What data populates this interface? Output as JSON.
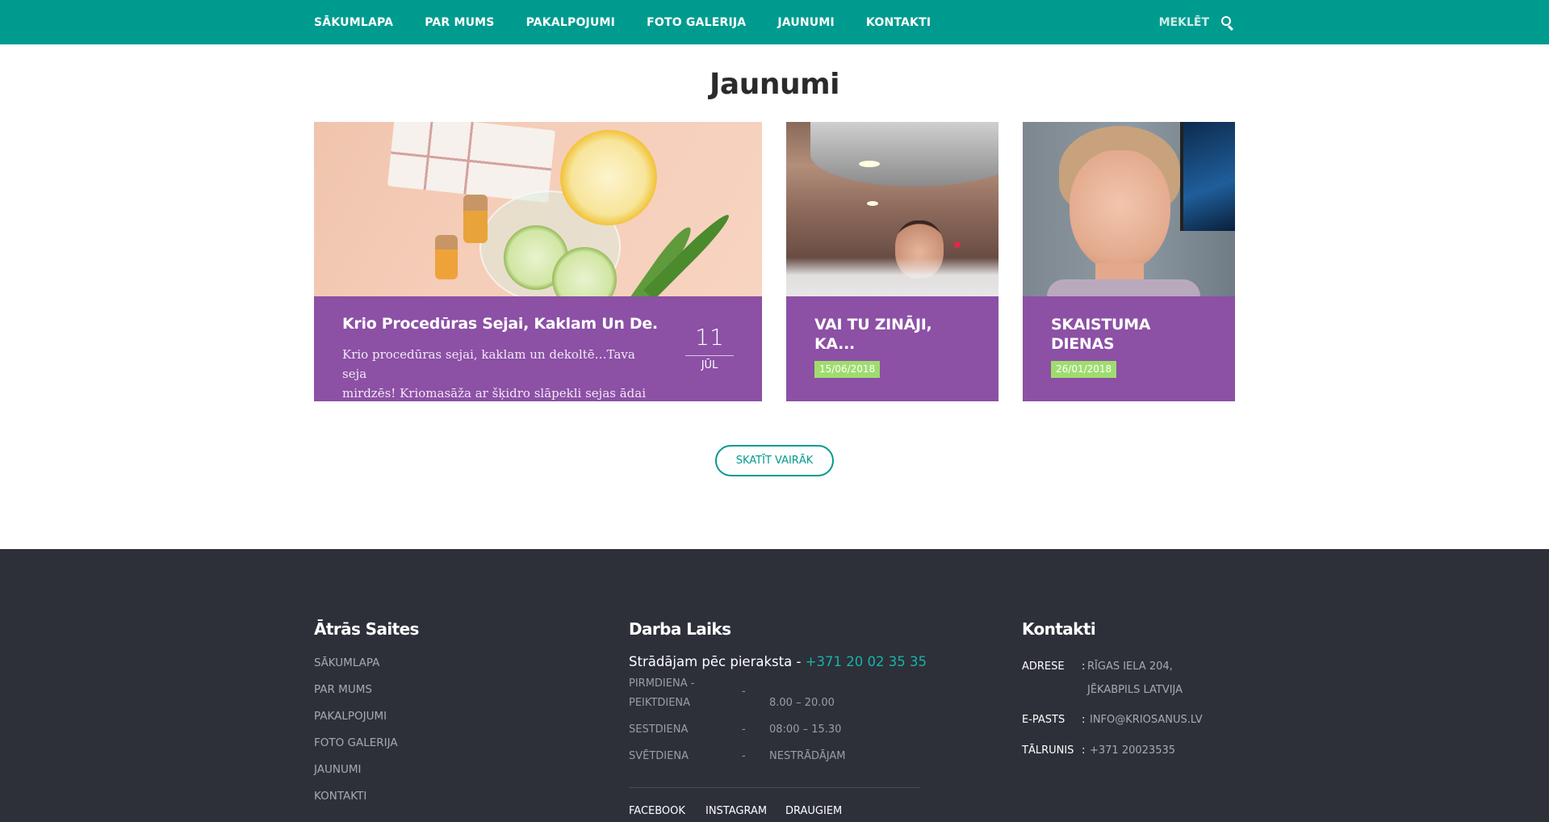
{
  "nav": {
    "items": [
      "SĀKUMLAPA",
      "PAR MUMS",
      "PAKALPOJUMI",
      "FOTO GALERIJA",
      "JAUNUMI",
      "KONTAKTI"
    ],
    "search_label": "MEKLĒT",
    "search_icon": "search-icon"
  },
  "news": {
    "title": "Jaunumi",
    "featured": {
      "title": "Krio Procedūras Sejai, Kaklam Un De..",
      "excerpt_line1": "Krio procedūras sejai, kaklam un dekoltē…Tava seja",
      "excerpt_line2": "mirdzēs! Kriomasāža ar šķidro slāpekli sejas ādai ..",
      "day": "11",
      "month": "JŪL"
    },
    "cards": [
      {
        "title_line1": "VAI TU ZINĀJI,",
        "title_line2": "KA...",
        "date": "15/06/2018"
      },
      {
        "title_line1": "SKAISTUMA",
        "title_line2": "DIENAS",
        "date": "26/01/2018"
      }
    ],
    "more_button": "SKATĪT VAIRĀK"
  },
  "footer": {
    "quick_links": {
      "heading": "Ātrās Saites",
      "items": [
        "SĀKUMLAPA",
        "PAR MUMS",
        "PAKALPOJUMI",
        "FOTO GALERIJA",
        "JAUNUMI",
        "KONTAKTI"
      ]
    },
    "hours": {
      "heading": "Darba Laiks",
      "intro": "Strādājam pēc pieraksta - ",
      "phone": "+371 20 02 35 35",
      "rows": [
        {
          "day_line1": "PIRMDIENA -",
          "day_line2": "PEIKTDIENA",
          "dash": "-",
          "time": "8.00 – 20.00"
        },
        {
          "day_line1": "SESTDIENA",
          "dash": "-",
          "time": "08:00 – 15.30"
        },
        {
          "day_line1": "SVĒTDIENA",
          "dash": "-",
          "time": "NESTRĀDĀJAM"
        }
      ],
      "social": [
        "FACEBOOK",
        "INSTAGRAM",
        "DRAUGIEM"
      ]
    },
    "contacts": {
      "heading": "Kontakti",
      "address_label": "ADRESE",
      "address_line1": "RĪGAS IELA 204,",
      "address_line2": "JĒKABPILS LATVIJA",
      "email_label": "E-PASTS",
      "email": "INFO@KRIOSANUS.LV",
      "phone_label": "TĀLRUNIS",
      "phone": "+371 20023535",
      "colon": ":"
    }
  },
  "colors": {
    "nav_bg": "#009b8f",
    "card_overlay": "#8c50a5",
    "date_badge": "#9fdc6f",
    "footer_bg": "#2d3039",
    "accent_teal": "#16b4a6"
  }
}
